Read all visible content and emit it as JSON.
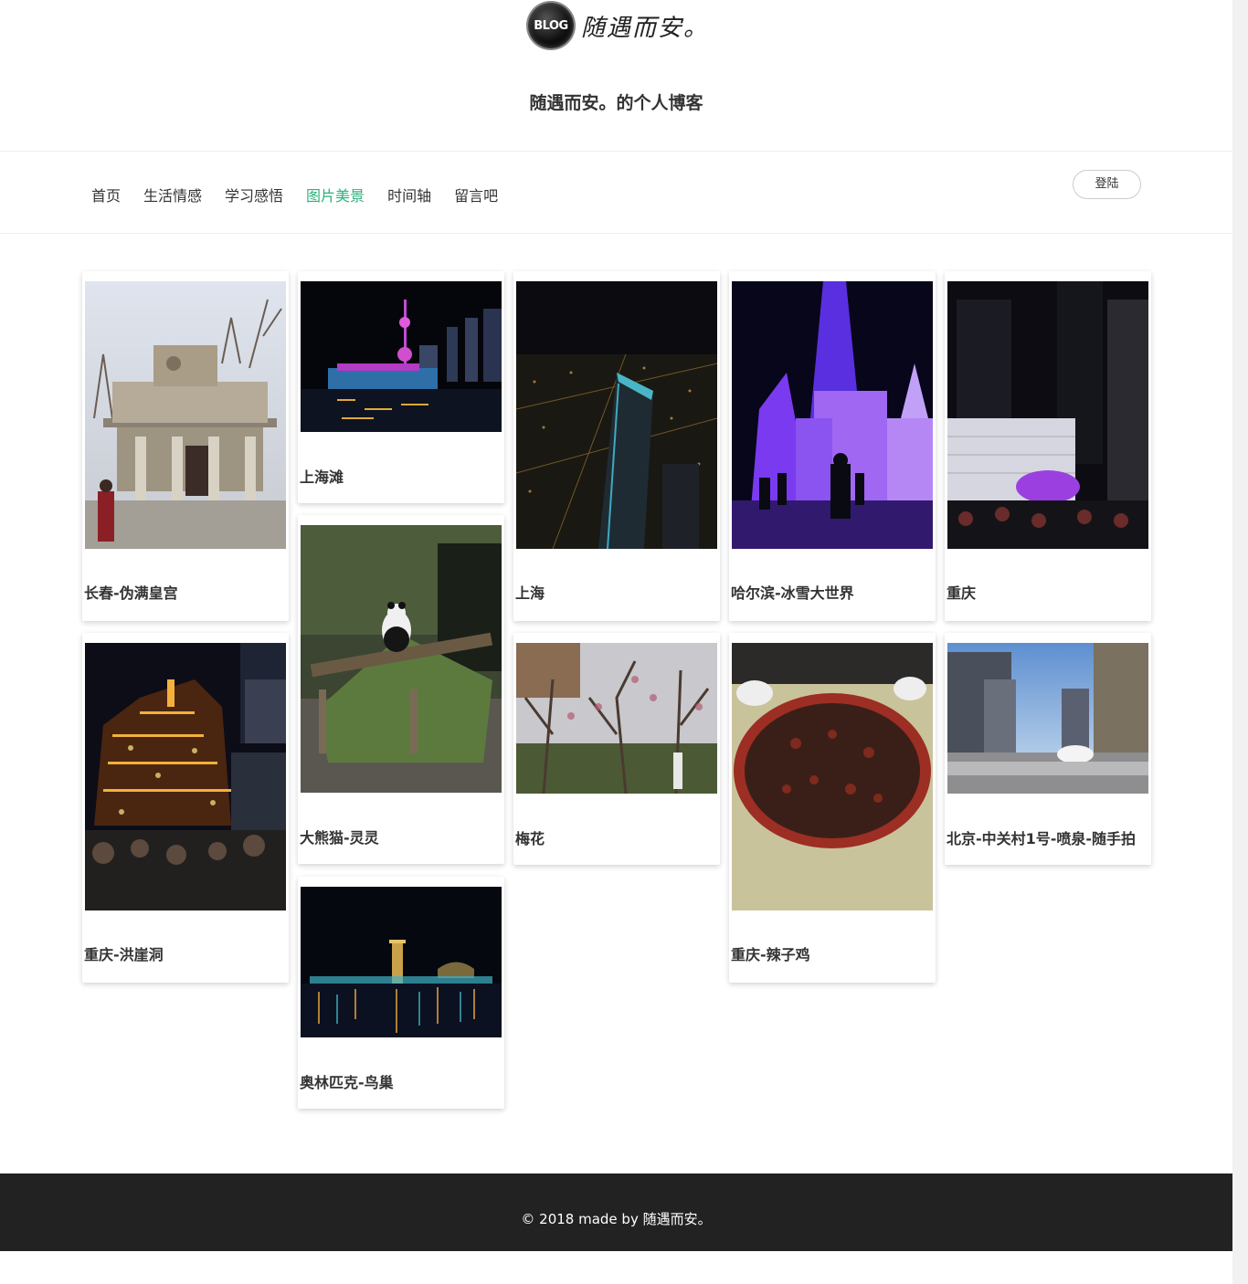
{
  "header": {
    "logo_badge": "BLOG",
    "logo_text": "随遇而安。",
    "site_title": "随遇而安。的个人博客"
  },
  "nav": {
    "items": [
      {
        "label": "首页"
      },
      {
        "label": "生活情感"
      },
      {
        "label": "学习感悟"
      },
      {
        "label": "图片美景",
        "active": true
      },
      {
        "label": "时间轴"
      },
      {
        "label": "留言吧"
      }
    ],
    "login_label": "登陆",
    "active_color": "#2ab27b"
  },
  "gallery": [
    {
      "title": "长春-伪满皇宫",
      "icon": "palace-photo"
    },
    {
      "title": "上海滩",
      "icon": "shanghai-bund-photo"
    },
    {
      "title": "上海",
      "icon": "shanghai-night-photo"
    },
    {
      "title": "哈尔滨-冰雪大世界",
      "icon": "ice-world-photo"
    },
    {
      "title": "重庆",
      "icon": "chongqing-street-photo"
    },
    {
      "title": "大熊猫-灵灵",
      "icon": "panda-photo"
    },
    {
      "title": "重庆-洪崖洞",
      "icon": "hongyadong-photo"
    },
    {
      "title": "梅花",
      "icon": "plum-blossom-photo"
    },
    {
      "title": "重庆-辣子鸡",
      "icon": "spicy-chicken-photo"
    },
    {
      "title": "北京-中关村1号-喷泉-随手拍",
      "icon": "fountain-photo"
    },
    {
      "title": "奥林匹克-鸟巢",
      "icon": "birds-nest-photo"
    }
  ],
  "footer": {
    "text": "© 2018 made by 随遇而安。",
    "background": "#222222"
  }
}
